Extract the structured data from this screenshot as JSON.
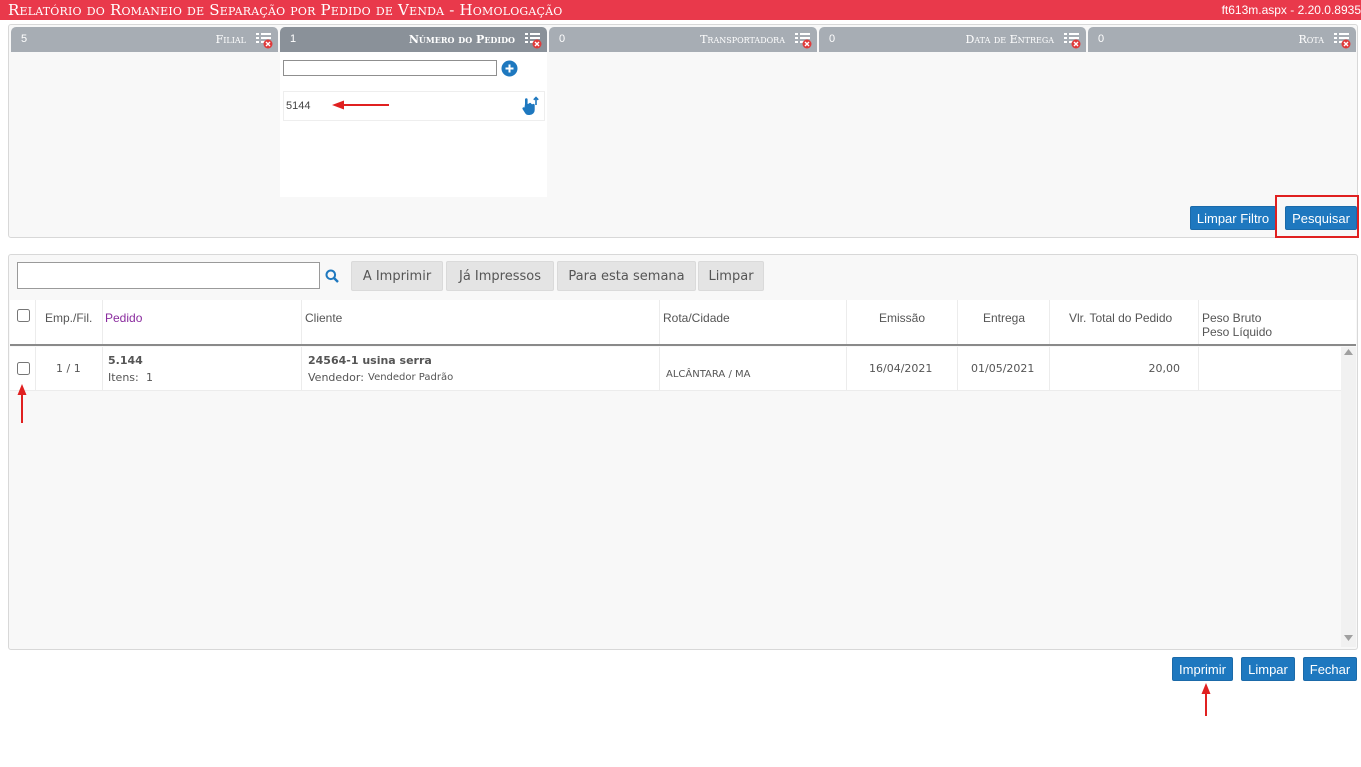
{
  "header": {
    "title": "Relatório do Romaneio de Separação por Pedido de Venda  - Homologação",
    "version": "ft613m.aspx - 2.20.0.8935"
  },
  "filters": [
    {
      "count": "5",
      "label": "Filial",
      "active": false,
      "icon": "filter-clear-icon"
    },
    {
      "count": "1",
      "label": "Número do Pedido",
      "active": true,
      "icon": "filter-clear-icon"
    },
    {
      "count": "0",
      "label": "Transportadora",
      "active": false,
      "icon": "filter-clear-icon"
    },
    {
      "count": "0",
      "label": "Data de Entrega",
      "active": false,
      "icon": "filter-clear-icon"
    },
    {
      "count": "0",
      "label": "Rota",
      "active": false,
      "icon": "filter-clear-icon"
    }
  ],
  "pedido_filter": {
    "input_value": "",
    "items": [
      "5144"
    ]
  },
  "filter_actions": {
    "clear_label": "Limpar Filtro",
    "search_label": "Pesquisar"
  },
  "grid": {
    "search_value": "",
    "quick_filters": [
      "A Imprimir",
      "Já Impressos",
      "Para esta semana",
      "Limpar"
    ],
    "columns": {
      "emp": "Emp./Fil.",
      "pedido": "Pedido",
      "cliente": "Cliente",
      "rota": "Rota/Cidade",
      "emissao": "Emissão",
      "entrega": "Entrega",
      "valor": "Vlr. Total do Pedido",
      "peso_bruto": "Peso Bruto",
      "peso_liquido": "Peso Líquido"
    },
    "rows": [
      {
        "emp": "1 / 1",
        "pedido": "5.144",
        "itens_label": "Itens:",
        "itens": "1",
        "cliente": "24564-1 usina serra",
        "vendedor_label": "Vendedor:",
        "vendedor": "Vendedor Padrão",
        "rota": "ALCÂNTARA / MA",
        "emissao": "16/04/2021",
        "entrega": "01/05/2021",
        "valor": "20,00",
        "peso": ""
      }
    ]
  },
  "footer_actions": {
    "print_label": "Imprimir",
    "clear_label": "Limpar",
    "close_label": "Fechar"
  },
  "colors": {
    "title_bar": "#e9394b",
    "primary_button": "#1e78bf",
    "annotation": "#e02020",
    "pedido_header": "#8a2b9e"
  }
}
